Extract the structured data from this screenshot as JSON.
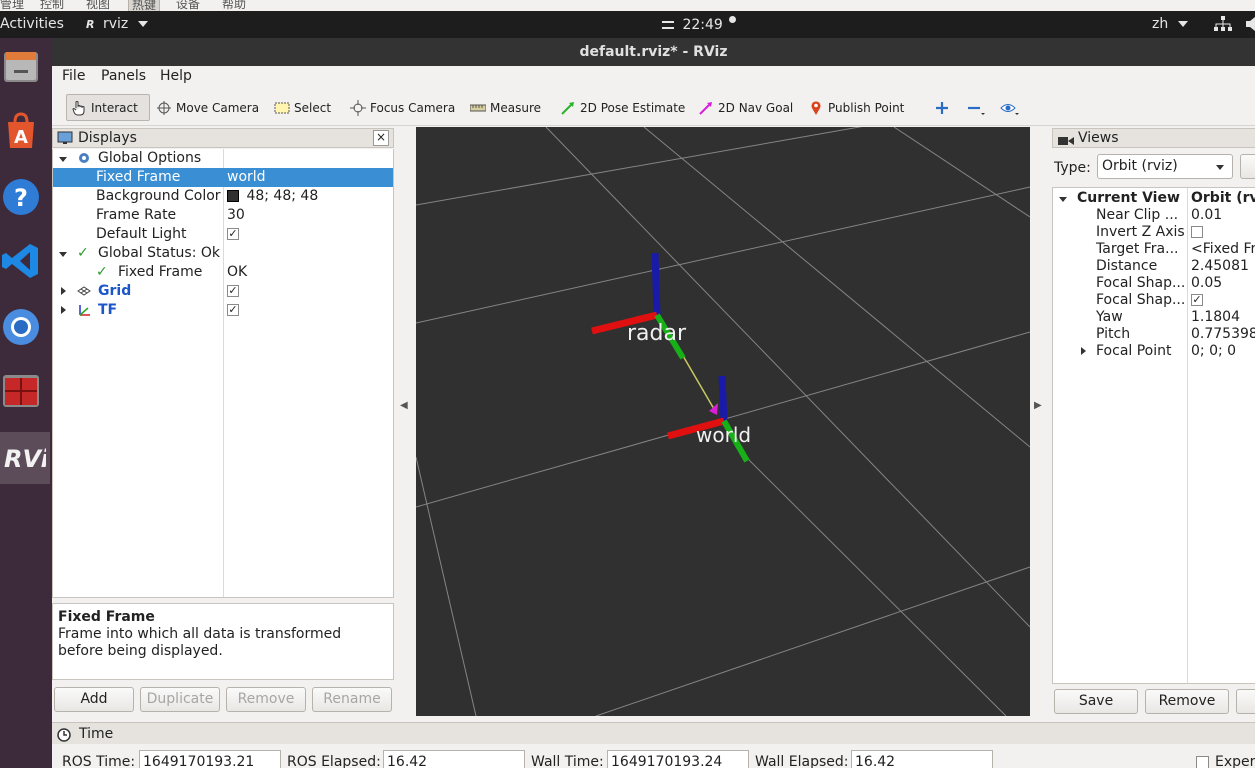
{
  "behind_window": {
    "items": [
      "管理",
      "控制",
      "视图",
      "热键",
      "设备",
      "帮助"
    ]
  },
  "topbar": {
    "activities": "Activities",
    "app_name": "rviz",
    "clock": "22:49",
    "lang": "zh"
  },
  "window": {
    "title": "default.rviz* - RViz"
  },
  "menu": {
    "file": "File",
    "panels": "Panels",
    "help": "Help"
  },
  "toolbar": {
    "interact": "Interact",
    "move_camera": "Move Camera",
    "select": "Select",
    "focus_camera": "Focus Camera",
    "measure": "Measure",
    "pose_estimate": "2D Pose Estimate",
    "nav_goal": "2D Nav Goal",
    "publish_point": "Publish Point"
  },
  "displays": {
    "title": "Displays",
    "close": "×",
    "global_options": "Global Options",
    "fixed_frame_label": "Fixed Frame",
    "fixed_frame_value": "world",
    "bg_color_label": "Background Color",
    "bg_color_value": "48; 48; 48",
    "bg_color_swatch": "#303030",
    "frame_rate_label": "Frame Rate",
    "frame_rate_value": "30",
    "default_light_label": "Default Light",
    "default_light_checked": "✓",
    "global_status": "Global Status: Ok",
    "status_fixed_frame_label": "Fixed Frame",
    "status_fixed_frame_value": "OK",
    "grid": "Grid",
    "grid_checked": "✓",
    "tf": "TF",
    "tf_checked": "✓"
  },
  "description": {
    "title": "Fixed Frame",
    "text": "Frame into which all data is transformed before being displayed."
  },
  "display_buttons": {
    "add": "Add",
    "duplicate": "Duplicate",
    "remove": "Remove",
    "rename": "Rename"
  },
  "scene": {
    "frame_radar": "radar",
    "frame_world": "world",
    "background": "#303030"
  },
  "views": {
    "title": "Views",
    "type_label": "Type:",
    "type_value": "Orbit (rviz)",
    "current_view": "Current View",
    "current_view_value": "Orbit (rviz)",
    "rows": [
      {
        "label": "Near Clip ...",
        "value": "0.01"
      },
      {
        "label": "Invert Z Axis",
        "value": ""
      },
      {
        "label": "Target Fra...",
        "value": "<Fixed Frame>"
      },
      {
        "label": "Distance",
        "value": "2.45081"
      },
      {
        "label": "Focal Shap...",
        "value": "0.05"
      },
      {
        "label": "Focal Shap...",
        "value": "✓"
      },
      {
        "label": "Yaw",
        "value": "1.1804"
      },
      {
        "label": "Pitch",
        "value": "0.775398"
      },
      {
        "label": "Focal Point",
        "value": "0; 0; 0"
      }
    ],
    "save": "Save",
    "remove": "Remove"
  },
  "time": {
    "title": "Time",
    "ros_time_label": "ROS Time:",
    "ros_time_value": "1649170193.21",
    "ros_elapsed_label": "ROS Elapsed:",
    "ros_elapsed_value": "16.42",
    "wall_time_label": "Wall Time:",
    "wall_time_value": "1649170193.24",
    "wall_elapsed_label": "Wall Elapsed:",
    "wall_elapsed_value": "16.42",
    "experimental": "Experimental"
  }
}
